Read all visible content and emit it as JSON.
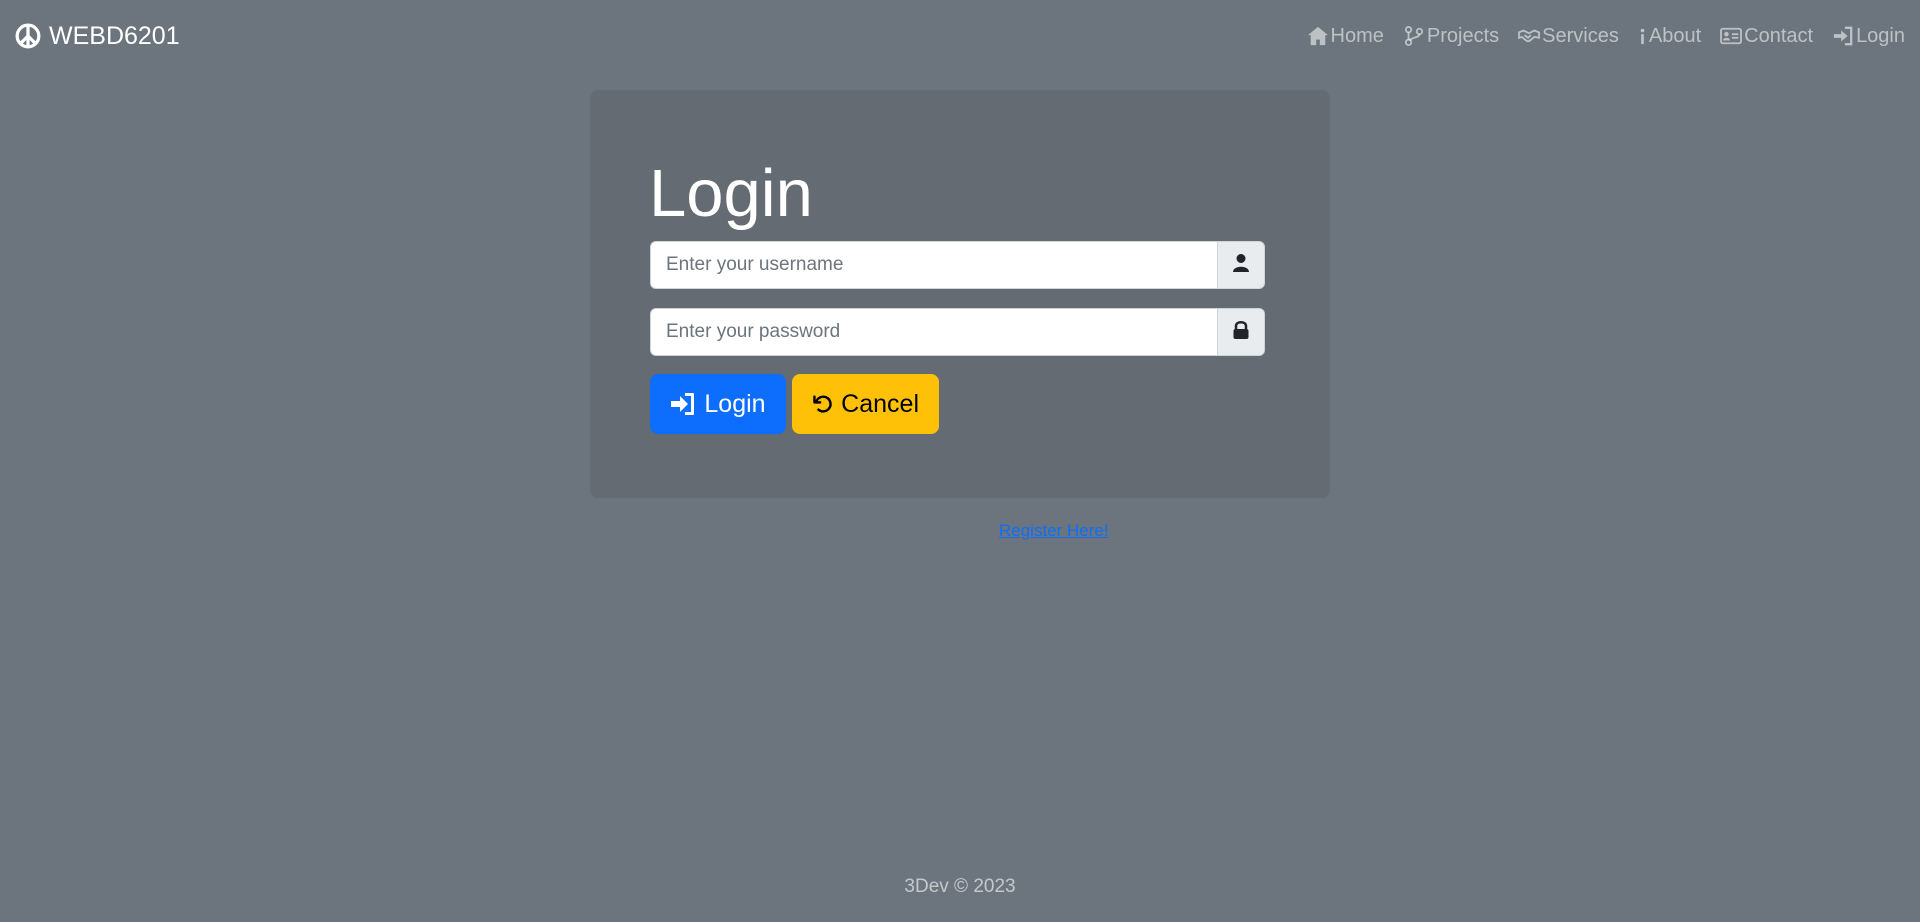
{
  "navbar": {
    "brand": "WEBD6201",
    "items": [
      {
        "label": "Home",
        "icon": "home-icon"
      },
      {
        "label": "Projects",
        "icon": "branch-icon"
      },
      {
        "label": "Services",
        "icon": "handshake-icon"
      },
      {
        "label": "About",
        "icon": "info-icon"
      },
      {
        "label": "Contact",
        "icon": "contact-card-icon"
      },
      {
        "label": "Login",
        "icon": "sign-in-icon"
      }
    ]
  },
  "login": {
    "title": "Login",
    "username_placeholder": "Enter your username",
    "password_placeholder": "Enter your password",
    "login_button": "Login",
    "cancel_button": "Cancel",
    "register_link": "Register Here!"
  },
  "footer": {
    "text": "3Dev © 2023"
  },
  "colors": {
    "background": "#6c757d",
    "card": "#646b73",
    "primary": "#0d6efd",
    "warning": "#ffc107"
  }
}
